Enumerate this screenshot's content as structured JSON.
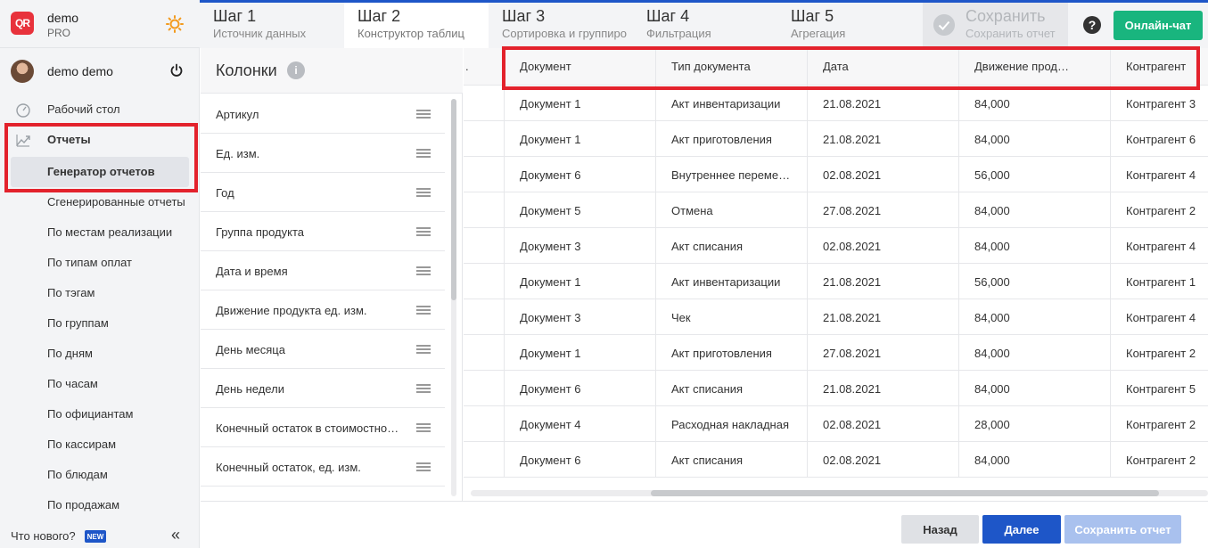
{
  "brand": {
    "logo_text": "QR",
    "name": "demo",
    "plan": "PRO"
  },
  "user": {
    "name": "demo demo"
  },
  "sidebar": {
    "items": [
      {
        "label": "Рабочий стол",
        "icon": "dashboard-icon"
      },
      {
        "label": "Отчеты",
        "icon": "chart-icon"
      },
      {
        "label": "Генератор отчетов"
      },
      {
        "label": "Сгенерированные отчеты"
      },
      {
        "label": "По местам реализации"
      },
      {
        "label": "По типам оплат"
      },
      {
        "label": "По тэгам"
      },
      {
        "label": "По группам"
      },
      {
        "label": "По дням"
      },
      {
        "label": "По часам"
      },
      {
        "label": "По официантам"
      },
      {
        "label": "По кассирам"
      },
      {
        "label": "По блюдам"
      },
      {
        "label": "По продажам"
      }
    ],
    "whats_new": "Что нового?",
    "new_badge": "NEW"
  },
  "steps": [
    {
      "title": "Шаг 1",
      "subtitle": "Источник данных"
    },
    {
      "title": "Шаг 2",
      "subtitle": "Конструктор таблиц"
    },
    {
      "title": "Шаг 3",
      "subtitle": "Сортировка и группировка"
    },
    {
      "title": "Шаг 4",
      "subtitle": "Фильтрация"
    },
    {
      "title": "Шаг 5",
      "subtitle": "Агрегация"
    }
  ],
  "save_step": {
    "title": "Сохранить",
    "subtitle": "Сохранить отчет"
  },
  "chat_button": "Онлайн-чат",
  "columns_panel": {
    "title": "Колонки",
    "items": [
      "Артикул",
      "Ед. изм.",
      "Год",
      "Группа продукта",
      "Дата и время",
      "Движение продукта ед. изм.",
      "День месяца",
      "День недели",
      "Конечный остаток в стоимостном выражении",
      "Конечный остаток, ед. изм."
    ]
  },
  "table": {
    "headers": [
      "Документ",
      "Тип документа",
      "Дата",
      "Движение продукта",
      "Контрагент"
    ],
    "rows": [
      [
        "Документ 1",
        "Акт инвентаризации",
        "21.08.2021",
        "84,000",
        "Контрагент 3"
      ],
      [
        "Документ 1",
        "Акт приготовления",
        "21.08.2021",
        "84,000",
        "Контрагент 6"
      ],
      [
        "Документ 6",
        "Внутреннее перемещение",
        "02.08.2021",
        "56,000",
        "Контрагент 4"
      ],
      [
        "Документ 5",
        "Отмена",
        "27.08.2021",
        "84,000",
        "Контрагент 2"
      ],
      [
        "Документ 3",
        "Акт списания",
        "02.08.2021",
        "84,000",
        "Контрагент 4"
      ],
      [
        "Документ 1",
        "Акт инвентаризации",
        "21.08.2021",
        "56,000",
        "Контрагент 1"
      ],
      [
        "Документ 3",
        "Чек",
        "21.08.2021",
        "84,000",
        "Контрагент 4"
      ],
      [
        "Документ 1",
        "Акт приготовления",
        "27.08.2021",
        "84,000",
        "Контрагент 2"
      ],
      [
        "Документ 6",
        "Акт списания",
        "21.08.2021",
        "84,000",
        "Контрагент 5"
      ],
      [
        "Документ 4",
        "Расходная накладная",
        "02.08.2021",
        "28,000",
        "Контрагент 2"
      ],
      [
        "Документ 6",
        "Акт списания",
        "02.08.2021",
        "84,000",
        "Контрагент 2"
      ]
    ]
  },
  "footer": {
    "back": "Назад",
    "next": "Далее",
    "save": "Сохранить отчет"
  },
  "colors": {
    "accent": "#1e56c8",
    "chat": "#19b57e",
    "highlight": "#e3222c",
    "logo": "#e8323c"
  }
}
